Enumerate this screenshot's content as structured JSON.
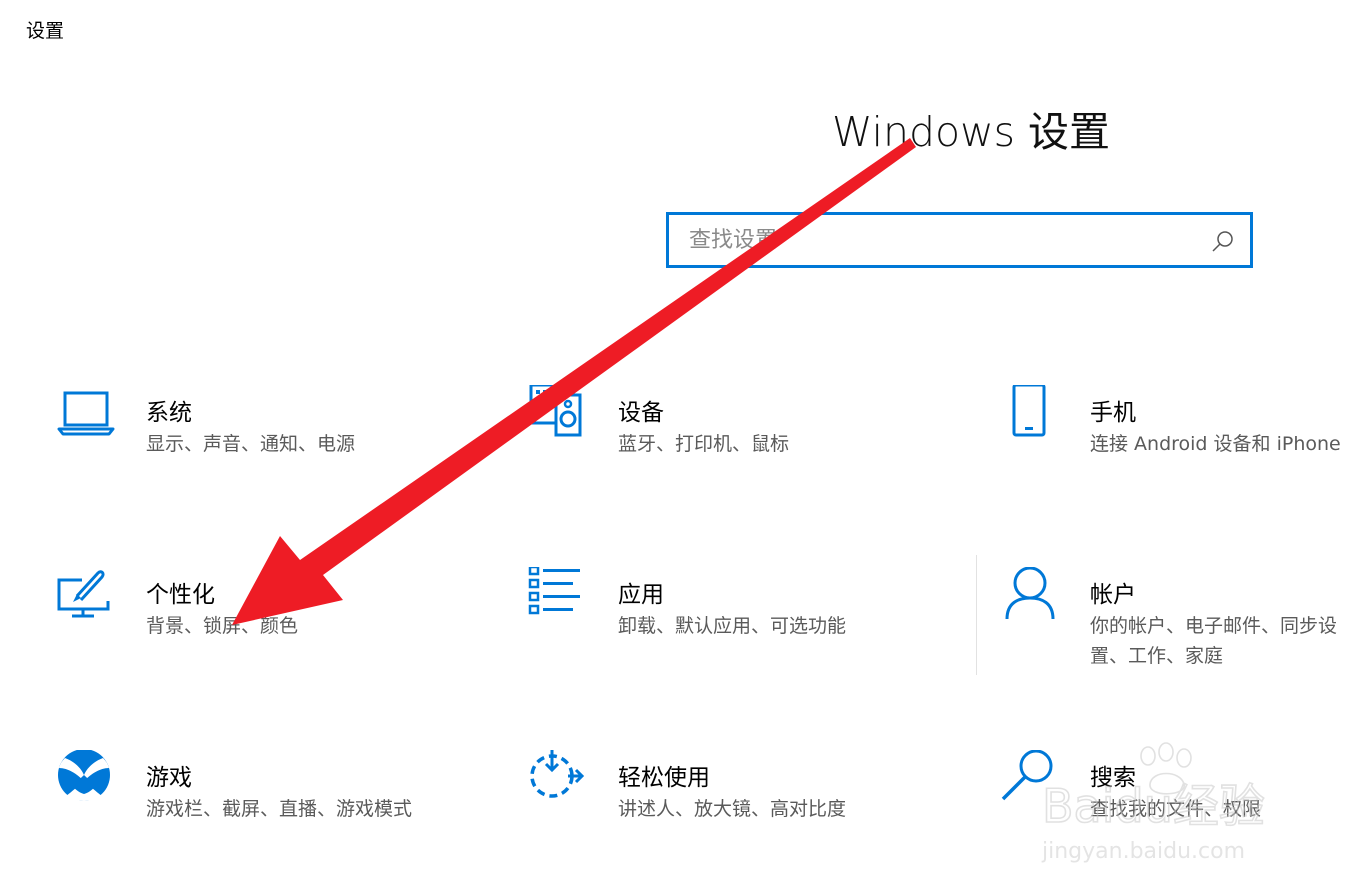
{
  "window": {
    "title": "设置"
  },
  "header": {
    "title": "Windows 设置"
  },
  "search": {
    "placeholder": "查找设置",
    "value": "",
    "icon": "search-icon"
  },
  "accent_color": "#0078d7",
  "annotation": {
    "arrow_color": "#ee1c25"
  },
  "tiles": [
    {
      "title": "系统",
      "desc": "显示、声音、通知、电源",
      "icon": "laptop-icon"
    },
    {
      "title": "设备",
      "desc": "蓝牙、打印机、鼠标",
      "icon": "devices-icon"
    },
    {
      "title": "手机",
      "desc": "连接 Android 设备和 iPhone",
      "icon": "phone-icon"
    },
    {
      "title": "个性化",
      "desc": "背景、锁屏、颜色",
      "icon": "personalization-icon"
    },
    {
      "title": "应用",
      "desc": "卸载、默认应用、可选功能",
      "icon": "apps-icon"
    },
    {
      "title": "帐户",
      "desc": "你的帐户、电子邮件、同步设置、工作、家庭",
      "icon": "account-icon"
    },
    {
      "title": "游戏",
      "desc": "游戏栏、截屏、直播、游戏模式",
      "icon": "xbox-icon"
    },
    {
      "title": "轻松使用",
      "desc": "讲述人、放大镜、高对比度",
      "icon": "ease-of-access-icon"
    },
    {
      "title": "搜索",
      "desc": "查找我的文件、权限",
      "icon": "search-category-icon"
    }
  ],
  "watermark": {
    "brand": "Baidu经验",
    "url": "jingyan.baidu.com"
  }
}
